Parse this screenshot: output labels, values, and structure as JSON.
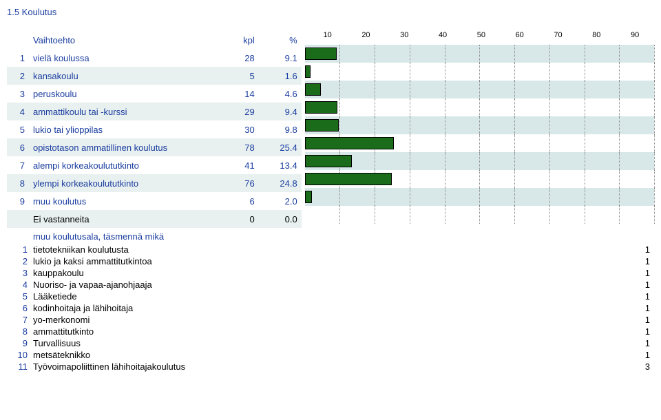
{
  "section_title": "1.5 Koulutus",
  "headers": {
    "option": "Vaihtoehto",
    "count": "kpl",
    "percent": "%"
  },
  "rows": [
    {
      "idx": "1",
      "label": "vielä koulussa",
      "count": "28",
      "pct": "9.1",
      "value": 9.1
    },
    {
      "idx": "2",
      "label": "kansakoulu",
      "count": "5",
      "pct": "1.6",
      "value": 1.6
    },
    {
      "idx": "3",
      "label": "peruskoulu",
      "count": "14",
      "pct": "4.6",
      "value": 4.6
    },
    {
      "idx": "4",
      "label": "ammattikoulu tai -kurssi",
      "count": "29",
      "pct": "9.4",
      "value": 9.4
    },
    {
      "idx": "5",
      "label": "lukio tai ylioppilas",
      "count": "30",
      "pct": "9.8",
      "value": 9.8
    },
    {
      "idx": "6",
      "label": "opistotason ammatillinen koulutus",
      "count": "78",
      "pct": "25.4",
      "value": 25.4
    },
    {
      "idx": "7",
      "label": "alempi korkeakoulututkinto",
      "count": "41",
      "pct": "13.4",
      "value": 13.4
    },
    {
      "idx": "8",
      "label": "ylempi korkeakoulututkinto",
      "count": "76",
      "pct": "24.8",
      "value": 24.8
    },
    {
      "idx": "9",
      "label": "muu koulutus",
      "count": "6",
      "pct": "2.0",
      "value": 2.0
    },
    {
      "idx": "",
      "label": "Ei vastanneita",
      "count": "0",
      "pct": "0.0",
      "value": 0.0
    }
  ],
  "axis_ticks": [
    "10",
    "20",
    "30",
    "40",
    "50",
    "60",
    "70",
    "80",
    "90"
  ],
  "list2_header": "muu koulutusala, täsmennä mikä",
  "list2": [
    {
      "n": "1",
      "t": "tietotekniikan koulutusta",
      "v": "1"
    },
    {
      "n": "2",
      "t": "lukio ja kaksi ammattitutkintoa",
      "v": "1"
    },
    {
      "n": "3",
      "t": "kauppakoulu",
      "v": "1"
    },
    {
      "n": "4",
      "t": "Nuoriso- ja vapaa-ajanohjaaja",
      "v": "1"
    },
    {
      "n": "5",
      "t": "Lääketiede",
      "v": "1"
    },
    {
      "n": "6",
      "t": "kodinhoitaja ja lähihoitaja",
      "v": "1"
    },
    {
      "n": "7",
      "t": "yo-merkonomi",
      "v": "1"
    },
    {
      "n": "8",
      "t": "ammattitutkinto",
      "v": "1"
    },
    {
      "n": "9",
      "t": "Turvallisuus",
      "v": "1"
    },
    {
      "n": "10",
      "t": "metsäteknikko",
      "v": "1"
    },
    {
      "n": "11",
      "t": "Työvoimapoliittinen lähihoitajakoulutus",
      "v": "3"
    }
  ],
  "chart_data": {
    "type": "bar",
    "orientation": "horizontal",
    "title": "1.5 Koulutus",
    "xlabel": "%",
    "xlim": [
      0,
      100
    ],
    "ticks": [
      10,
      20,
      30,
      40,
      50,
      60,
      70,
      80,
      90
    ],
    "categories": [
      "vielä koulussa",
      "kansakoulu",
      "peruskoulu",
      "ammattikoulu tai -kurssi",
      "lukio tai ylioppilas",
      "opistotason ammatillinen koulutus",
      "alempi korkeakoulututkinto",
      "ylempi korkeakoulututkinto",
      "muu koulutus",
      "Ei vastanneita"
    ],
    "values": [
      9.1,
      1.6,
      4.6,
      9.4,
      9.8,
      25.4,
      13.4,
      24.8,
      2.0,
      0.0
    ],
    "counts": [
      28,
      5,
      14,
      29,
      30,
      78,
      41,
      76,
      6,
      0
    ]
  }
}
